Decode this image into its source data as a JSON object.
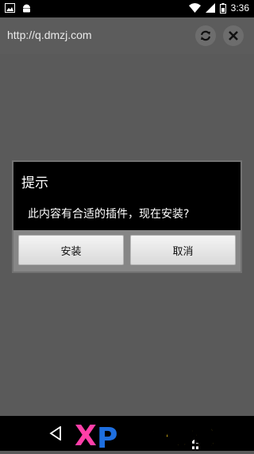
{
  "status_bar": {
    "time": "3:36",
    "icons": [
      "image-icon",
      "android-icon",
      "wifi-icon",
      "signal-icon",
      "battery-icon"
    ]
  },
  "browser": {
    "url": "http://q.dmzj.com",
    "buttons": [
      "refresh-icon",
      "close-icon"
    ]
  },
  "dialog": {
    "title": "提示",
    "message": "此内容有合适的插件，现在安装?",
    "buttons": {
      "install": "安装",
      "cancel": "取消"
    }
  },
  "watermark": {
    "text": "手机之家",
    "logo": "XP"
  },
  "colors": {
    "background": "#5a5a5a",
    "dialog_bg": "#000000",
    "watermark_yellow": "#ffd21a",
    "watermark_pink": "#ff3fa8",
    "watermark_blue": "#1e6fe0"
  }
}
